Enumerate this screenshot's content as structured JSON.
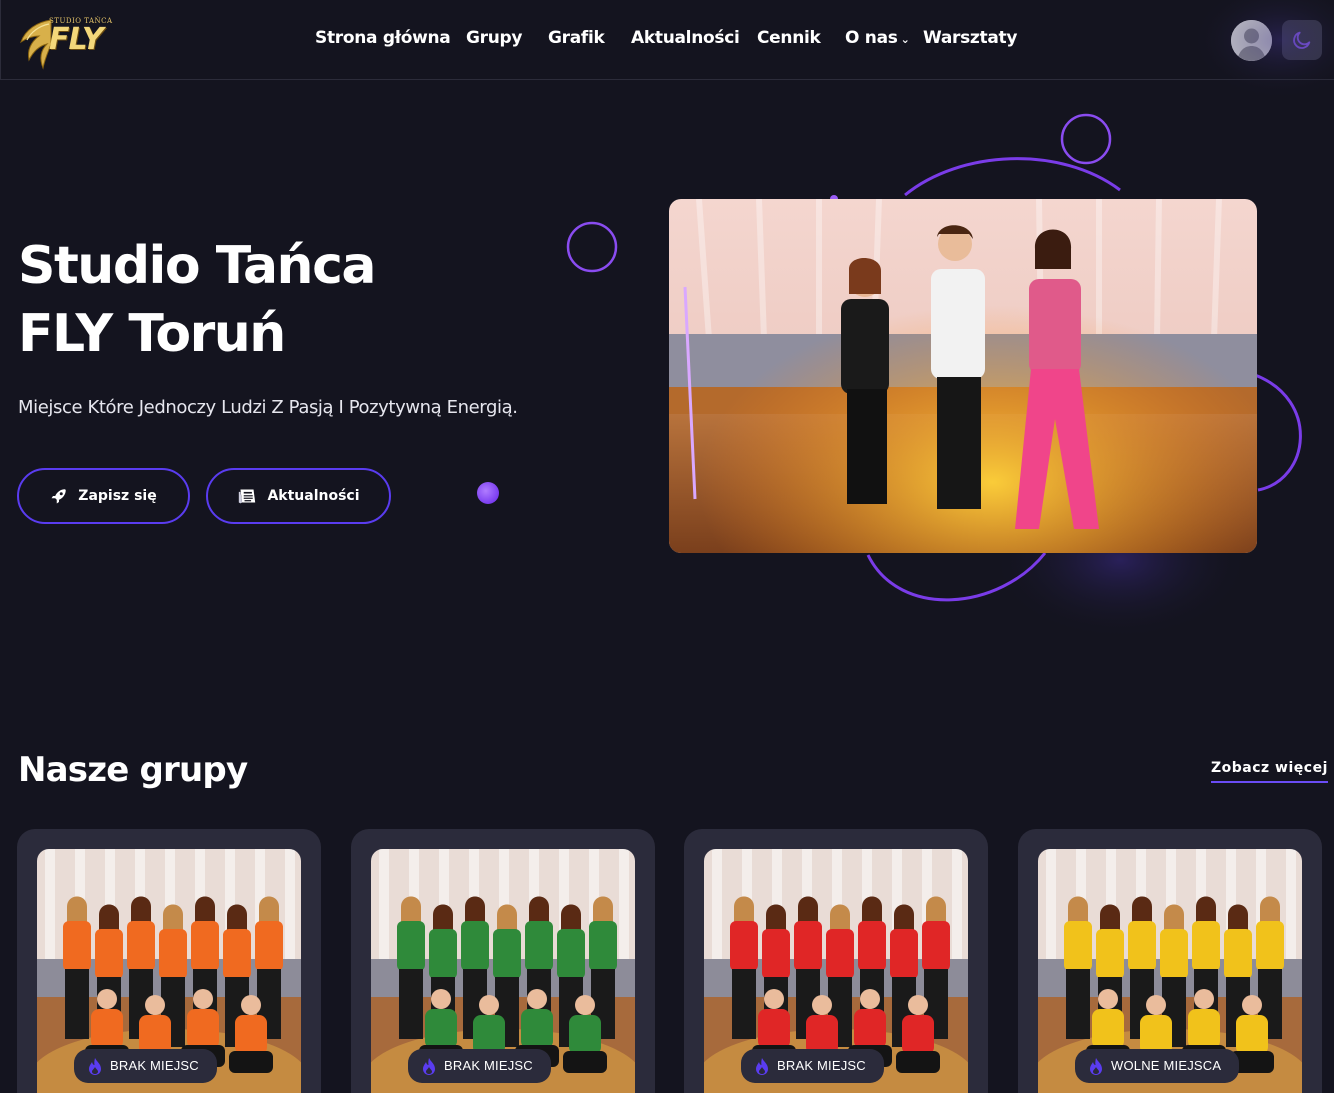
{
  "brand": {
    "logo_small_text": "STUDIO TAŃCA",
    "logo_word": "FLY",
    "gold": "#e6c56a"
  },
  "nav": {
    "items": [
      {
        "label": "Strona główna"
      },
      {
        "label": "Grupy"
      },
      {
        "label": "Grafik"
      },
      {
        "label": "Aktualności"
      },
      {
        "label": "Cennik"
      },
      {
        "label": "O nas",
        "dropdown": true
      },
      {
        "label": "Warsztaty"
      }
    ]
  },
  "header": {
    "avatar_icon": "user-avatar-icon",
    "theme_icon": "moon-icon"
  },
  "hero": {
    "title_line1": "Studio Tańca",
    "title_line2": "FLY Toruń",
    "subtitle": "Miejsce Które Jednoczy Ludzi Z Pasją I Pozytywną Energią.",
    "signup_label": "Zapisz się",
    "signup_icon": "rocket-icon",
    "news_label": "Aktualności",
    "news_icon": "newspaper-icon"
  },
  "groups": {
    "title": "Nasze grupy",
    "see_more": "Zobacz więcej",
    "cards": [
      {
        "badge": "BRAK MIEJSC",
        "shirt": "#f06a20"
      },
      {
        "badge": "BRAK MIEJSC",
        "shirt": "#2f8a3a"
      },
      {
        "badge": "BRAK MIEJSC",
        "shirt": "#e02626"
      },
      {
        "badge": "WOLNE MIEJSCA",
        "shirt": "#f1c21b"
      }
    ]
  },
  "colors": {
    "background": "#14141f",
    "accent": "#5a3cf0",
    "accent_light": "#8a5cf6",
    "card": "#2b2b3b"
  }
}
